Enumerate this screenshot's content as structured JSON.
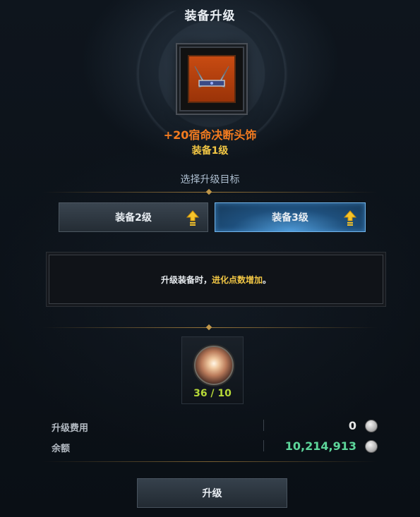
{
  "title": "装备升级",
  "item": {
    "name": "+20宿命决断头饰",
    "level": "装备1级",
    "icon": "headpiece-icon"
  },
  "select_label": "选择升级目标",
  "options": [
    {
      "label": "装备2级",
      "selected": false,
      "icon": "upgrade-arrow-icon"
    },
    {
      "label": "装备3级",
      "selected": true,
      "icon": "upgrade-arrow-icon"
    }
  ],
  "message": {
    "prefix": "升级装备时，",
    "highlight": "进化点数增加",
    "suffix": "。"
  },
  "material": {
    "icon": "evolution-orb-icon",
    "count": "36 / 10"
  },
  "costs": [
    {
      "label": "升级费用",
      "value": "0",
      "icon": "silver-coin-icon"
    },
    {
      "label": "余额",
      "value": "10,214,913",
      "icon": "silver-coin-icon"
    }
  ],
  "upgrade_button": "升级",
  "colors": {
    "item_name": "#f37b1f",
    "item_level": "#f1c644",
    "highlight": "#f1c644",
    "material_count": "#b6d838",
    "balance": "#5dd69a",
    "cost": "#e6e6e6",
    "active_option": "#2f6fa6"
  }
}
